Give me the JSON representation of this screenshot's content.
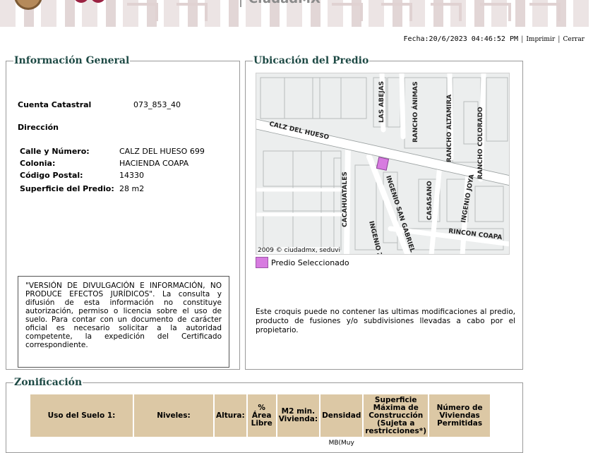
{
  "header": {
    "title": "CiudadMX"
  },
  "topbar": {
    "fecha": "Fecha:20/6/2023 04:46:52 PM",
    "imprimir": "Imprimir",
    "cerrar": "Cerrar"
  },
  "info_general": {
    "legend": "Información General",
    "cuenta_label": "Cuenta Catastral",
    "cuenta_value": "073_853_40",
    "direccion_label": "Dirección",
    "calle_label": "Calle y Número:",
    "calle_value": "CALZ DEL HUESO 699",
    "colonia_label": "Colonia:",
    "colonia_value": "HACIENDA COAPA",
    "cp_label": "Código Postal:",
    "cp_value": "14330",
    "superficie_label": "Superficie del Predio:",
    "superficie_value": "28 m2",
    "disclaimer": "\"VERSIÓN DE DIVULGACIÓN E INFORMACIÓN, NO PRODUCE EFECTOS JURÍDICOS\". La consulta y difusión de esta información no constituye autorización, permiso o licencia sobre el uso de suelo. Para contar con un documento de carácter oficial es necesario solicitar a la autoridad competente, la expedición del Certificado correspondiente."
  },
  "ubicacion": {
    "legend": "Ubicación del Predio",
    "map_labels": {
      "calz": "CALZ DEL HUESO",
      "abejas": "LAS ABEJAS",
      "animas": "RANCHO ÁNIMAS",
      "altamira": "RANCHO ALTAMIRA",
      "colorado": "RANCHO COLORADO",
      "cacahuatales": "CACAHUATALES",
      "ingenio_sg": "INGENIO SAN GABRIEL",
      "ingenio_za": "INGENIO ZA",
      "casasano": "CASASANO",
      "joya": "INGENIO JOYA",
      "rincon": "RINCON COAPA"
    },
    "map_credit": "2009 © ciudadmx, seduvi",
    "legend_label": "Predio Seleccionado",
    "note": "Este croquis puede no contener las ultimas modificaciones al predio, producto de fusiones y/o subdivisiones llevadas a cabo por el propietario.",
    "colors": {
      "predio": "#d77be0",
      "streets": "#ffffff",
      "lots": "#b8bcbc"
    }
  },
  "zonificacion": {
    "legend": "Zonificación",
    "headers": [
      "Uso del Suelo 1:",
      "Niveles:",
      "Altura:",
      "% Área Libre",
      "M2 min. Vivienda:",
      "Densidad",
      "Superficie Máxima de Construcción (Sujeta a restricciones*)",
      "Número de Viviendas Permitidas"
    ],
    "row_partial": [
      "",
      "",
      "",
      "",
      "",
      "MB(Muy",
      "",
      ""
    ]
  },
  "colors": {
    "legend_text": "#1e4a45",
    "table_header_bg": "#dcc8a5",
    "brand": "#9b2242"
  }
}
